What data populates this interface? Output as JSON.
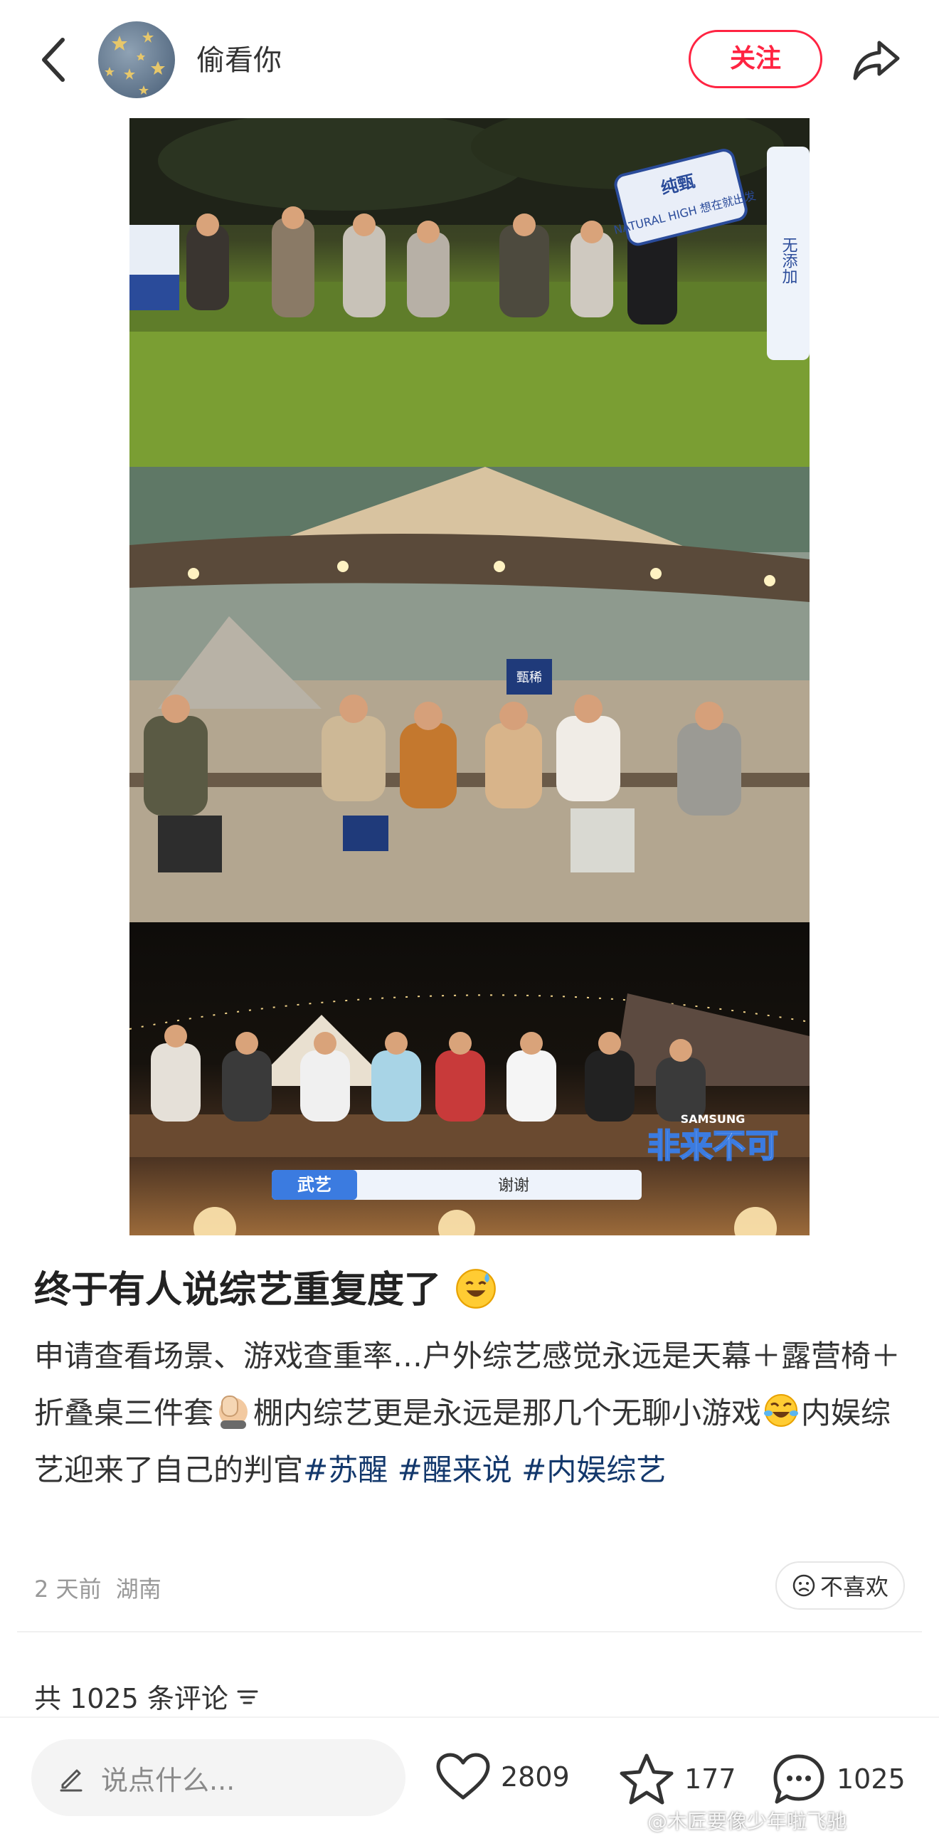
{
  "header": {
    "back_icon": "chevron-left-icon",
    "author_name": "偷看你",
    "follow_label": "关注",
    "share_icon": "share-arrow-icon"
  },
  "photos": {
    "photo1": {
      "sign_text": "纯甄",
      "banner_text": "NATURAL HIGH 想在就出发",
      "board_text": "无添加"
    },
    "photo2": {
      "sign_text": "甄稀"
    },
    "photo3": {
      "caption_name": "武艺",
      "caption_text": "谢谢",
      "logo_text": "非来不可",
      "brand_text": "SAMSUNG"
    }
  },
  "post": {
    "title": "终于有人说综艺重复度了",
    "body_part1": "申请查看场景、游戏查重率…户外综艺感觉永远是天幕＋露营椅＋折叠桌三件套",
    "body_part2": "棚内综艺更是永远是那几个无聊小游戏",
    "body_part3": "内娱综艺迎来了自己的判官",
    "hashtags": [
      "#苏醒",
      "#醒来说",
      "#内娱综艺"
    ],
    "date": "2 天前",
    "location": "湖南",
    "dislike_label": "不喜欢"
  },
  "comments": {
    "header": "共 1025 条评论"
  },
  "bottom_bar": {
    "input_placeholder": "说点什么...",
    "likes": "2809",
    "collects": "177",
    "comments": "1025"
  },
  "watermark": "@木匠要像少年啦飞驰",
  "colors": {
    "accent": "#ff2442",
    "hashtag": "#13386c"
  }
}
